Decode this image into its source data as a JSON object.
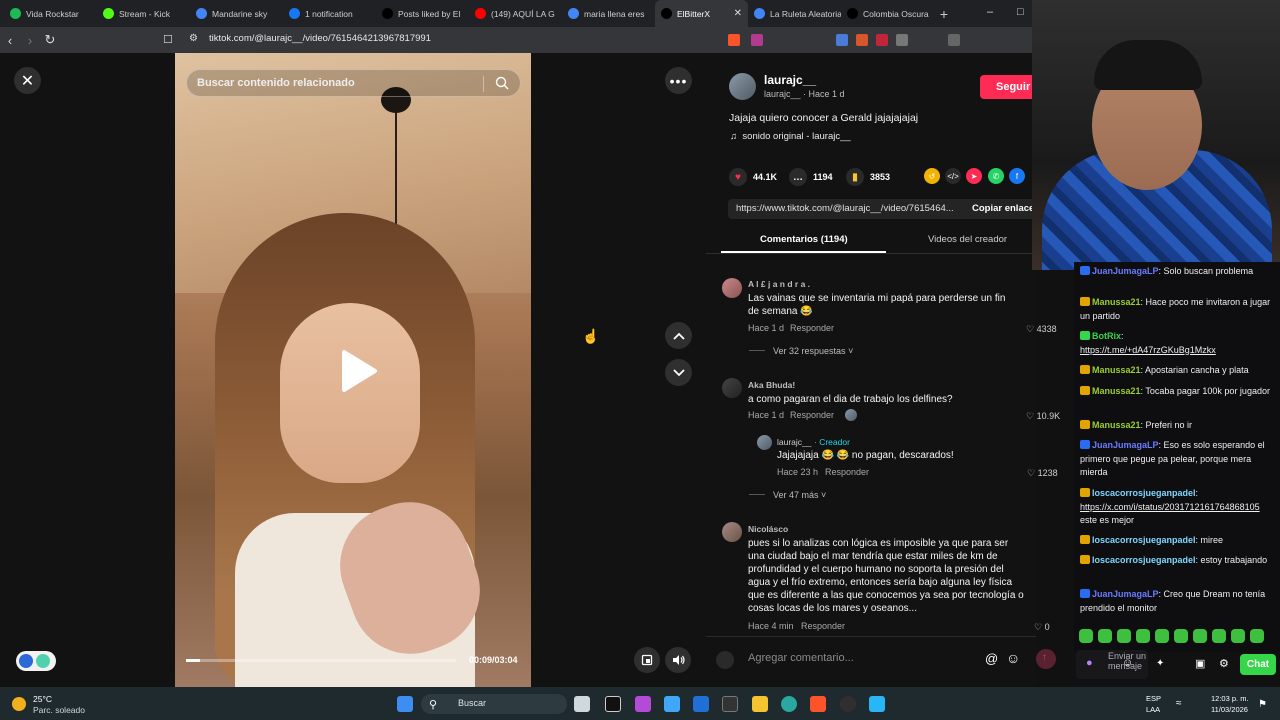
{
  "browser": {
    "tabs": [
      {
        "label": "Vida Rockstar",
        "color": "#1db954"
      },
      {
        "label": "Stream - Kick",
        "color": "#53fc18"
      },
      {
        "label": "Mandarine sky",
        "color": "#4285f4"
      },
      {
        "label": "1 notification",
        "color": "#1877f2"
      },
      {
        "label": "Posts liked by El",
        "color": "#000000"
      },
      {
        "label": "(149) AQUÍ LA G",
        "color": "#ff0000"
      },
      {
        "label": "maria llena eres",
        "color": "#4285f4"
      },
      {
        "label": "ElBitterX",
        "color": "#000000",
        "active": true
      },
      {
        "label": "La Ruleta Aleatoria",
        "color": "#4285f4"
      },
      {
        "label": "Colombia Oscura",
        "color": "#000000"
      }
    ],
    "url": "tiktok.com/@laurajc__/video/7615464213967817991"
  },
  "video": {
    "search_placeholder": "Buscar contenido relacionado",
    "time": "00:09/03:04",
    "progress": 0.05
  },
  "post": {
    "author": "laurajc__",
    "author_sub": "laurajc__ · Hace 1 d",
    "follow_label": "Seguir",
    "caption": "Jajaja quiero conocer a Gerald jajajajajaj",
    "sound": "sonido original - laurajc__",
    "likes": "44.1K",
    "comments_count": "1194",
    "saves": "3853",
    "link": "https://www.tiktok.com/@laurajc__/video/7615464...",
    "copy_label": "Copiar enlace",
    "tab_comments": "Comentarios (1194)",
    "tab_videos": "Videos del creador"
  },
  "comments": [
    {
      "name": "A l £ j a n d r a .",
      "text": "Las vainas que se inventaria mi papá para perderse un fin de semana 😂",
      "time": "Hace 1 d",
      "reply": "Responder",
      "likes": "4338",
      "more": "Ver 32 respuestas"
    },
    {
      "name": "Aka Bhuda!",
      "text": "a como pagaran el dia de trabajo los delfines?",
      "time": "Hace 1 d",
      "reply": "Responder",
      "likes": "10.9K",
      "more": "Ver 47 más"
    },
    {
      "name": "Nicolásco",
      "text": "pues si lo analizas con lógica es imposible ya que para ser una ciudad bajo el mar tendría que estar miles de km de profundidad y el cuerpo humano no soporta la presión del agua y el frío extremo, entonces sería bajo alguna ley física que es diferente a las que conocemos ya sea por tecnología o cosas locas de los mares y oseanos...",
      "time": "Hace 4 min",
      "reply": "Responder",
      "likes": "0"
    }
  ],
  "reply": {
    "name": "laurajc__",
    "creator_tag": "· Creador",
    "text": "Jajajajaja 😂 😂 no pagan, descarados!",
    "time": "Hace 23 h",
    "reply": "Responder",
    "likes": "1238"
  },
  "comment_input_placeholder": "Agregar comentario...",
  "chat": {
    "messages": [
      {
        "user": "JuanJumagaLP",
        "text": ": Solo buscan problema",
        "ucls": "u-blue"
      },
      {
        "user": "Manussa21",
        "text": ": Hace poco me invitaron a jugar un partido",
        "ucls": "u-gold"
      },
      {
        "user": "BotRix",
        "text": ":",
        "ucls": "u-green",
        "link": "https://t.me/+dA47rzGKuBg1Mzkx"
      },
      {
        "user": "Manussa21",
        "text": ": Apostarian cancha y plata",
        "ucls": "u-gold"
      },
      {
        "user": "Manussa21",
        "text": ": Tocaba pagar 100k por jugador",
        "ucls": "u-gold"
      },
      {
        "user": "Manussa21",
        "text": ": Preferi no ir",
        "ucls": "u-gold"
      },
      {
        "user": "JuanJumagaLP",
        "text": ": Eso es solo esperando el primero que pegue pa pelear, porque mera mierda",
        "ucls": "u-blue"
      },
      {
        "user": "loscacorrosjueganpadel",
        "text": ":",
        "ucls": "u-teal",
        "link": "https://x.com/i/status/2031712161764868105",
        "after": "este es mejor"
      },
      {
        "user": "loscacorrosjueganpadel",
        "text": ": miree",
        "ucls": "u-teal"
      },
      {
        "user": "loscacorrosjueganpadel",
        "text": ": estoy trabajando",
        "ucls": "u-teal"
      },
      {
        "user": "JuanJumagaLP",
        "text": ": Creo que Dream no tenía prendido el monitor",
        "ucls": "u-blue"
      }
    ],
    "input_placeholder": "Enviar un mensaje",
    "send_label": "Chat"
  },
  "taskbar": {
    "temp": "25°C",
    "weather": "Parc. soleado",
    "search": "Buscar",
    "lang1": "ESP",
    "lang2": "LAA",
    "time": "12:03 p. m.",
    "date": "11/03/2026"
  }
}
